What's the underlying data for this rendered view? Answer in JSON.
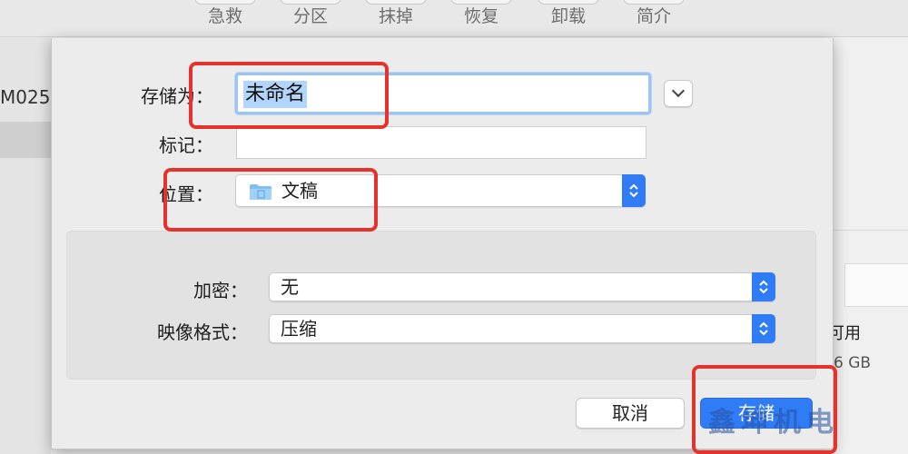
{
  "toolbar": {
    "items": [
      {
        "label": "急救",
        "icon": "first-aid-icon"
      },
      {
        "label": "分区",
        "icon": "partition-icon"
      },
      {
        "label": "抹掉",
        "icon": "erase-icon"
      },
      {
        "label": "恢复",
        "icon": "restore-icon"
      },
      {
        "label": "卸载",
        "icon": "unmount-icon"
      },
      {
        "label": "简介",
        "icon": "info-icon"
      }
    ]
  },
  "sidebar": {
    "disk_label": "M025."
  },
  "background_info": {
    "available_label": "可用",
    "available_value": "6 GB"
  },
  "dialog": {
    "save_as_label": "存储为：",
    "save_as_value": "未命名",
    "tags_label": "标记：",
    "tags_value": "",
    "location_label": "位置：",
    "location_value": "文稿",
    "location_icon": "folder-icon",
    "encryption_label": "加密：",
    "encryption_value": "无",
    "image_format_label": "映像格式：",
    "image_format_value": "压缩",
    "cancel_label": "取消",
    "save_label": "存储"
  },
  "watermark": {
    "text": "鑫坤机电"
  },
  "colors": {
    "accent": "#2f7cf6",
    "annotation": "#e5322d",
    "selection": "#b3d4fb"
  }
}
